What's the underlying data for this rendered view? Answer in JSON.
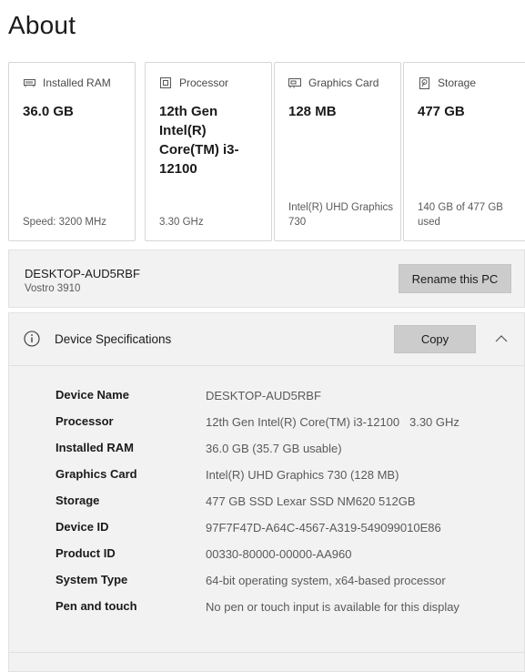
{
  "page": {
    "title": "About"
  },
  "cards": [
    {
      "icon": "ram-icon",
      "label": "Installed RAM",
      "value": "36.0 GB",
      "foot": "Speed: 3200 MHz"
    },
    {
      "icon": "processor-icon",
      "label": "Processor",
      "value": "12th Gen Intel(R) Core(TM) i3-12100",
      "foot": "3.30 GHz"
    },
    {
      "icon": "graphics-card-icon",
      "label": "Graphics Card",
      "value": "128 MB",
      "foot": "Intel(R) UHD Graphics 730"
    },
    {
      "icon": "storage-icon",
      "label": "Storage",
      "value": "477 GB",
      "foot": "140 GB of 477 GB used"
    }
  ],
  "pc": {
    "name": "DESKTOP-AUD5RBF",
    "model": "Vostro 3910",
    "rename_label": "Rename this PC"
  },
  "specs": {
    "title": "Device Specifications",
    "copy_label": "Copy",
    "rows": [
      {
        "label": "Device Name",
        "value": "DESKTOP-AUD5RBF"
      },
      {
        "label": "Processor",
        "value": "12th Gen Intel(R) Core(TM) i3-12100   3.30 GHz"
      },
      {
        "label": "Installed RAM",
        "value": "36.0 GB (35.7 GB usable)"
      },
      {
        "label": "Graphics Card",
        "value": "Intel(R) UHD Graphics 730 (128 MB)"
      },
      {
        "label": "Storage",
        "value": "477 GB SSD Lexar SSD NM620 512GB"
      },
      {
        "label": "Device ID",
        "value": "97F7F47D-A64C-4567-A319-549099010E86"
      },
      {
        "label": "Product ID",
        "value": "00330-80000-00000-AA960"
      },
      {
        "label": "System Type",
        "value": "64-bit operating system, x64-based processor"
      },
      {
        "label": "Pen and touch",
        "value": "No pen or touch input is available for this display"
      }
    ]
  },
  "icons": {
    "info": "info-icon",
    "collapse": "chevron-up-icon"
  }
}
